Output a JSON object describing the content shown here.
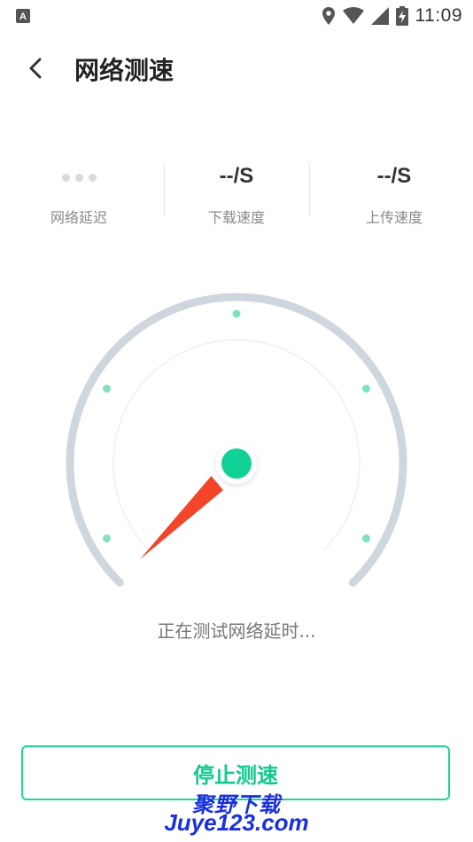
{
  "status_bar": {
    "time": "11:09",
    "left_icon": "a-icon",
    "icons": [
      "location-icon",
      "wifi-icon",
      "signal-icon",
      "battery-charging-icon"
    ]
  },
  "header": {
    "back_icon": "chevron-left-icon",
    "title": "网络测速"
  },
  "stats": {
    "latency": {
      "value": "",
      "label": "网络延迟"
    },
    "download": {
      "value": "--/S",
      "label": "下载速度"
    },
    "upload": {
      "value": "--/S",
      "label": "上传速度"
    }
  },
  "gauge": {
    "status_text": "正在测试网络延时...",
    "needle_value": 0
  },
  "actions": {
    "stop_label": "停止测速"
  },
  "watermark": {
    "line1": "聚野下载",
    "line2": "Juye123.com"
  },
  "colors": {
    "accent": "#12c98f",
    "needle": "#f2452a",
    "arc": "#ced6de",
    "watermark": "#1a2fe0"
  }
}
